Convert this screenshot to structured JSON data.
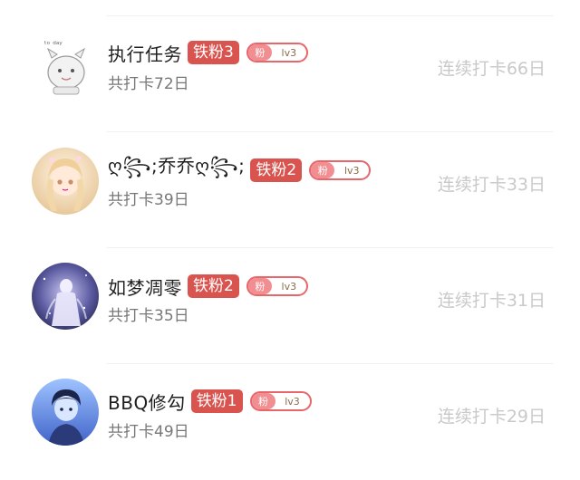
{
  "members": [
    {
      "name": "执行任务",
      "iron_badge": "铁粉3",
      "fan_tag": "粉",
      "fan_level": "lv3",
      "total": "共打卡72日",
      "streak": "连续打卡66日",
      "avatar_icon": "cartoon-sketch-avatar"
    },
    {
      "name": "ღ꧂;乔乔ღ꧂;",
      "iron_badge": "铁粉2",
      "fan_tag": "粉",
      "fan_level": "lv3",
      "total": "共打卡39日",
      "streak": "连续打卡33日",
      "avatar_icon": "anime-girl-avatar"
    },
    {
      "name": "如梦凋零",
      "iron_badge": "铁粉2",
      "fan_tag": "粉",
      "fan_level": "lv3",
      "total": "共打卡35日",
      "streak": "连续打卡31日",
      "avatar_icon": "night-figure-avatar"
    },
    {
      "name": "BBQ修勾",
      "iron_badge": "铁粉1",
      "fan_tag": "粉",
      "fan_level": "lv3",
      "total": "共打卡49日",
      "streak": "连续打卡29日",
      "avatar_icon": "blue-boy-avatar"
    }
  ]
}
